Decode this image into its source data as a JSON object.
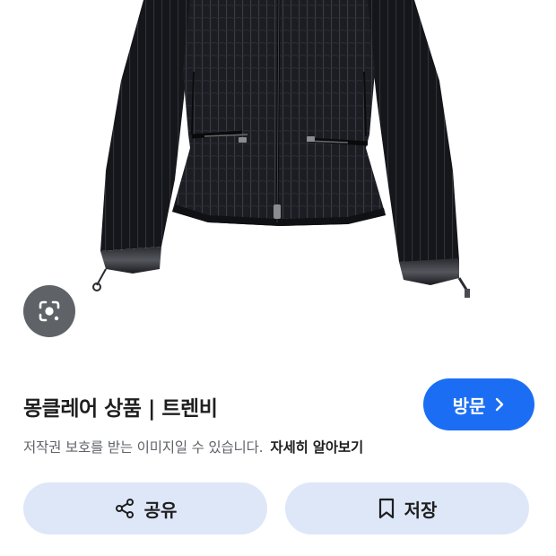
{
  "product": {
    "title": "몽클레어 상품 | 트렌비",
    "image_icon": "padded-jacket-photo"
  },
  "lens": {
    "icon": "lens-search-icon"
  },
  "visit": {
    "label": "방문",
    "icon": "chevron-right-icon",
    "color": "#1b6ef3"
  },
  "copyright": {
    "text": "저작권 보호를 받는 이미지일 수 있습니다.",
    "link": "자세히 알아보기"
  },
  "actions": {
    "share_label": "공유",
    "share_icon": "share-icon",
    "save_label": "저장",
    "save_icon": "bookmark-icon",
    "button_color": "#dde7f8"
  }
}
